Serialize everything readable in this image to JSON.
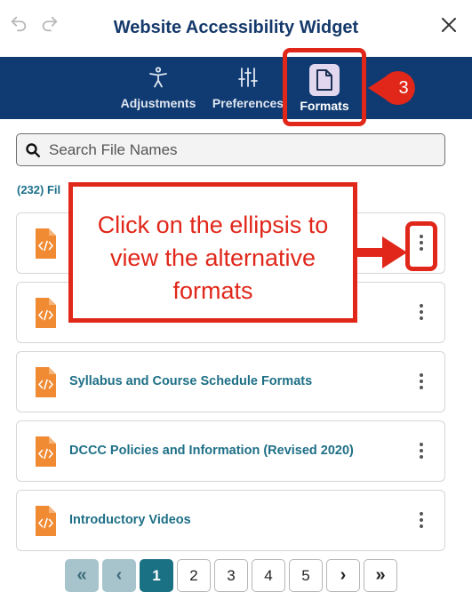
{
  "window": {
    "title": "Website Accessibility Widget"
  },
  "icons": {
    "undo": "undo-icon",
    "redo": "redo-icon",
    "close": "close-icon",
    "search": "search-icon",
    "file": "html-file-icon",
    "more": "vertical-ellipsis-icon"
  },
  "colors": {
    "header_bg": "#0f3a72",
    "title": "#15396a",
    "accent_teal": "#1b7184",
    "file_icon": "#f08a33",
    "annotation": "#e0271a",
    "active_tab_bg": "#e1d8ef"
  },
  "tabs": [
    {
      "label": "Adjustments",
      "icon": "accessibility-person-icon",
      "active": false
    },
    {
      "label": "Preferences",
      "icon": "sliders-icon",
      "active": false
    },
    {
      "label": "Formats",
      "icon": "document-icon",
      "active": true
    }
  ],
  "annotation": {
    "step_number": "3",
    "callout_text": "Click on the ellipsis to view the alternative formats"
  },
  "search": {
    "placeholder": "Search File Names",
    "value": ""
  },
  "files": {
    "count": "(232)",
    "count_label": "Fil",
    "items": [
      {
        "name": ""
      },
      {
        "name": ""
      },
      {
        "name": "Syllabus and Course Schedule Formats"
      },
      {
        "name": "DCCC Policies and Information (Revised 2020)"
      },
      {
        "name": "Introductory Videos"
      }
    ]
  },
  "pagination": {
    "first": "«",
    "prev": "‹",
    "pages": [
      "1",
      "2",
      "3",
      "4",
      "5"
    ],
    "current": "1",
    "next": "›",
    "last": "»"
  }
}
